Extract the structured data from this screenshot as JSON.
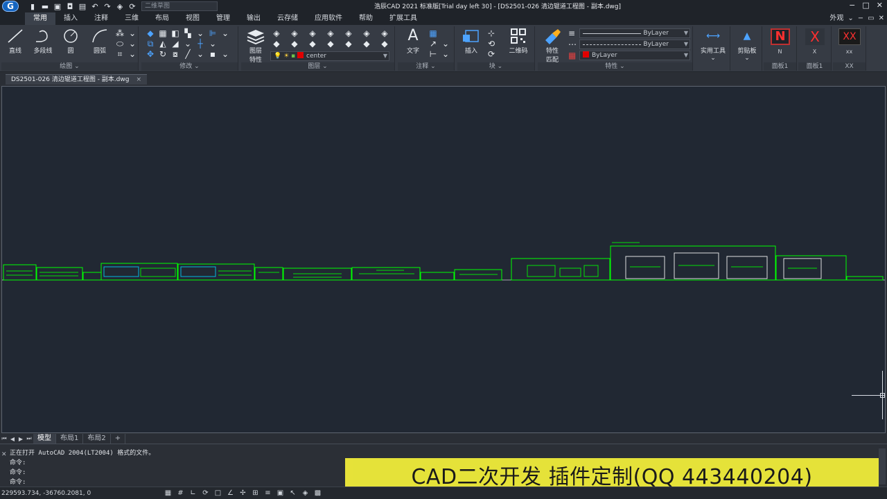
{
  "titlebar": {
    "title": "浩辰CAD 2021 标准版[Trial day left 30] - [DS2501-026 清边辊道工程图 - 副本.dwg]",
    "workspace": "二维草图"
  },
  "menu": {
    "tabs": [
      "常用",
      "插入",
      "注释",
      "三维",
      "布局",
      "视图",
      "管理",
      "输出",
      "云存储",
      "应用软件",
      "帮助",
      "扩展工具"
    ],
    "active_index": 0,
    "right_label": "外观"
  },
  "ribbon": {
    "draw": {
      "title": "绘图",
      "line": "直线",
      "polyline": "多段线",
      "circle": "圆",
      "arc": "圆弧"
    },
    "modify": {
      "title": "修改"
    },
    "layers": {
      "title": "图层",
      "layer_props_line1": "图层",
      "layer_props_line2": "特性",
      "current_layer": "center"
    },
    "annotate": {
      "title": "注释",
      "text": "文字"
    },
    "block": {
      "title": "块",
      "insert": "插入",
      "qrcode": "二维码"
    },
    "properties": {
      "title": "特性",
      "match_line1": "特性",
      "match_line2": "匹配",
      "linetype1": "ByLayer",
      "linetype2": "ByLayer",
      "color": "ByLayer"
    },
    "utilities": {
      "label": "实用工具"
    },
    "clipboard": {
      "label": "剪贴板"
    },
    "panel1": {
      "title": "面板1",
      "button": "N",
      "caption": "N"
    },
    "panel2": {
      "title": "面板1",
      "button": "X",
      "caption": "X"
    },
    "panel3": {
      "title": "XX",
      "button": "XX",
      "caption": "xx"
    }
  },
  "document_tab": {
    "label": "DS2501-026 清边辊道工程图 - 副本.dwg"
  },
  "layout_tabs": [
    "模型",
    "布局1",
    "布局2",
    "+"
  ],
  "command": {
    "lines": [
      "正在打开 AutoCAD 2004(LT2004) 格式的文件。",
      "命令:",
      "命令:",
      "命令:"
    ]
  },
  "banner": {
    "text": "CAD二次开发 插件定制(QQ 443440204)"
  },
  "status": {
    "coords": "229593.734, -36760.2081, 0"
  },
  "colors": {
    "drawing_bg": "#212833",
    "drawing_lines": "#00ff00",
    "banner_bg": "#ece83a",
    "accent_blue": "#1565c0"
  }
}
